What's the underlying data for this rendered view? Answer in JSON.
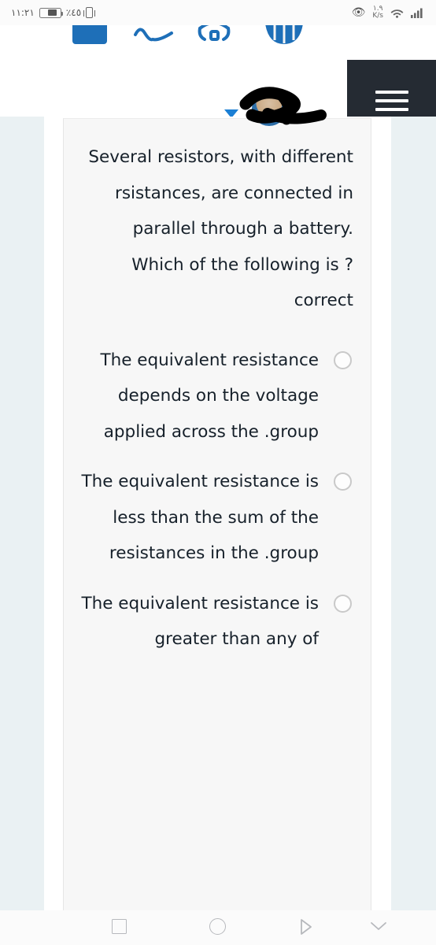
{
  "status_bar": {
    "time": "١١:٢١",
    "battery_percent": "٪٤٥",
    "data_speed_value": "١.٩",
    "data_speed_unit": "K/s",
    "icons": [
      "battery-icon",
      "vibrate-icon",
      "eye-icon",
      "data-speed-icon",
      "wifi-icon",
      "cellular-signal-icon"
    ]
  },
  "toolbar": {
    "icons": [
      "bookmark-icon",
      "signature-icon",
      "anchor-icon",
      "basket-icon"
    ],
    "menu_label": "☰",
    "accent_color": "#1e6fb8",
    "menu_panel_color": "#252b33"
  },
  "question": {
    "text": "Several resistors, with different rsistances, are connected in parallel through a battery. Which of the following is ?correct"
  },
  "options": [
    {
      "id": "option-1",
      "text": "The equivalent resistance depends on the voltage applied across the .group",
      "selected": false
    },
    {
      "id": "option-2",
      "text": "The equivalent resistance is less than the sum of the resistances in the .group",
      "selected": false
    },
    {
      "id": "option-3",
      "text": "The equivalent resistance is greater than any of",
      "selected": false
    }
  ],
  "nav_bar": {
    "items": [
      "recents-square-icon",
      "home-circle-icon",
      "back-triangle-icon",
      "collapse-chevron-icon"
    ]
  },
  "colors": {
    "page_band": "#eaf1f3",
    "card_bg": "#f7f7f7",
    "text": "#16202a",
    "radio_border": "#c9c9c9",
    "nav_icon": "#b7b9bd",
    "dropdown_triangle": "#1b7fd4"
  }
}
